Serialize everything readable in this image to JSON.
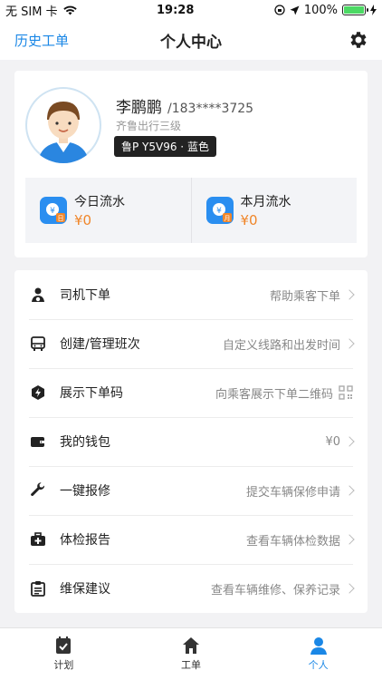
{
  "status_bar": {
    "carrier": "无 SIM 卡",
    "time": "19:28",
    "battery": "100%",
    "battery_level": 1.0
  },
  "navbar": {
    "left_label": "历史工单",
    "title": "个人中心",
    "settings_icon": "gear-icon"
  },
  "profile": {
    "name": "李鹏鹏",
    "phone": "/183****3725",
    "level": "齐鲁出行三级",
    "plate": "鲁P Y5V96 · 蓝色",
    "flows": [
      {
        "label": "今日流水",
        "value": "¥0",
        "badge": "日"
      },
      {
        "label": "本月流水",
        "value": "¥0",
        "badge": "月"
      }
    ]
  },
  "menu": [
    {
      "label": "司机下单",
      "sub": "帮助乘客下单",
      "icon": "driver-icon"
    },
    {
      "label": "创建/管理班次",
      "sub": "自定义线路和出发时间",
      "icon": "bus-icon"
    },
    {
      "label": "展示下单码",
      "sub": "向乘客展示下单二维码",
      "icon": "bolt-shield-icon"
    },
    {
      "label": "我的钱包",
      "sub": "¥0",
      "icon": "wallet-icon"
    },
    {
      "label": "一键报修",
      "sub": "提交车辆保修申请",
      "icon": "wrench-icon"
    },
    {
      "label": "体检报告",
      "sub": "查看车辆体检数据",
      "icon": "medical-kit-icon"
    },
    {
      "label": "维保建议",
      "sub": "查看车辆维修、保养记录",
      "icon": "clipboard-icon"
    }
  ],
  "tabs": [
    {
      "label": "计划",
      "icon": "plan-icon"
    },
    {
      "label": "工单",
      "icon": "home-icon"
    },
    {
      "label": "个人",
      "icon": "person-icon"
    }
  ],
  "colors": {
    "accent": "#1a87e6",
    "amount": "#f0862a",
    "plate_bg": "#222222"
  }
}
